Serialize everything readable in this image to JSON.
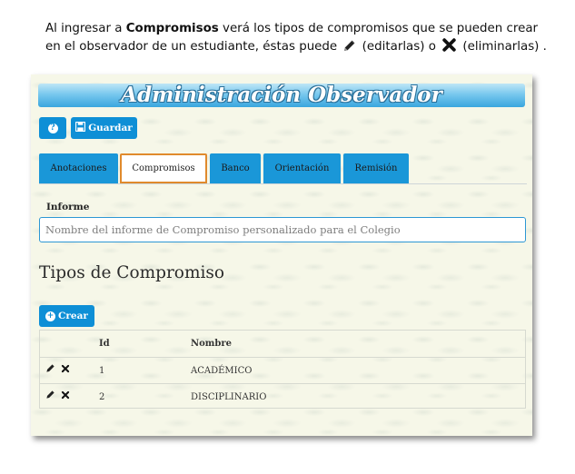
{
  "intro": {
    "text_before_bold": "Al ingresar a ",
    "bold_text": "Compromisos",
    "text_after_bold": " verá los tipos de compromisos que se pueden crear en el observador de un estudiante, éstas puede",
    "edit_text": " (editarlas) o ",
    "delete_text": " (eliminarlas)  ."
  },
  "app": {
    "title": "Administración Observador",
    "help_icon": "question-circle-icon",
    "save_label": "Guardar",
    "save_icon": "floppy-disk-icon"
  },
  "tabs": [
    {
      "label": "Anotaciones",
      "active": false
    },
    {
      "label": "Compromisos",
      "active": true
    },
    {
      "label": "Banco",
      "active": false
    },
    {
      "label": "Orientación",
      "active": false
    },
    {
      "label": "Remisión",
      "active": false
    }
  ],
  "informe": {
    "label": "Informe",
    "placeholder": "Nombre del informe de Compromiso personalizado para el Colegio"
  },
  "section": {
    "title": "Tipos de Compromiso",
    "create_label": "Crear",
    "create_icon": "plus-circle-icon"
  },
  "table": {
    "headers": {
      "actions": "",
      "id": "Id",
      "name": "Nombre"
    },
    "rows": [
      {
        "id": "1",
        "name": "ACADÉMICO"
      },
      {
        "id": "2",
        "name": "DISCIPLINARIO"
      }
    ]
  },
  "colors": {
    "accent": "#0e8fd6",
    "active_tab_border": "#e08a2c",
    "background": "#f6f7e8"
  }
}
